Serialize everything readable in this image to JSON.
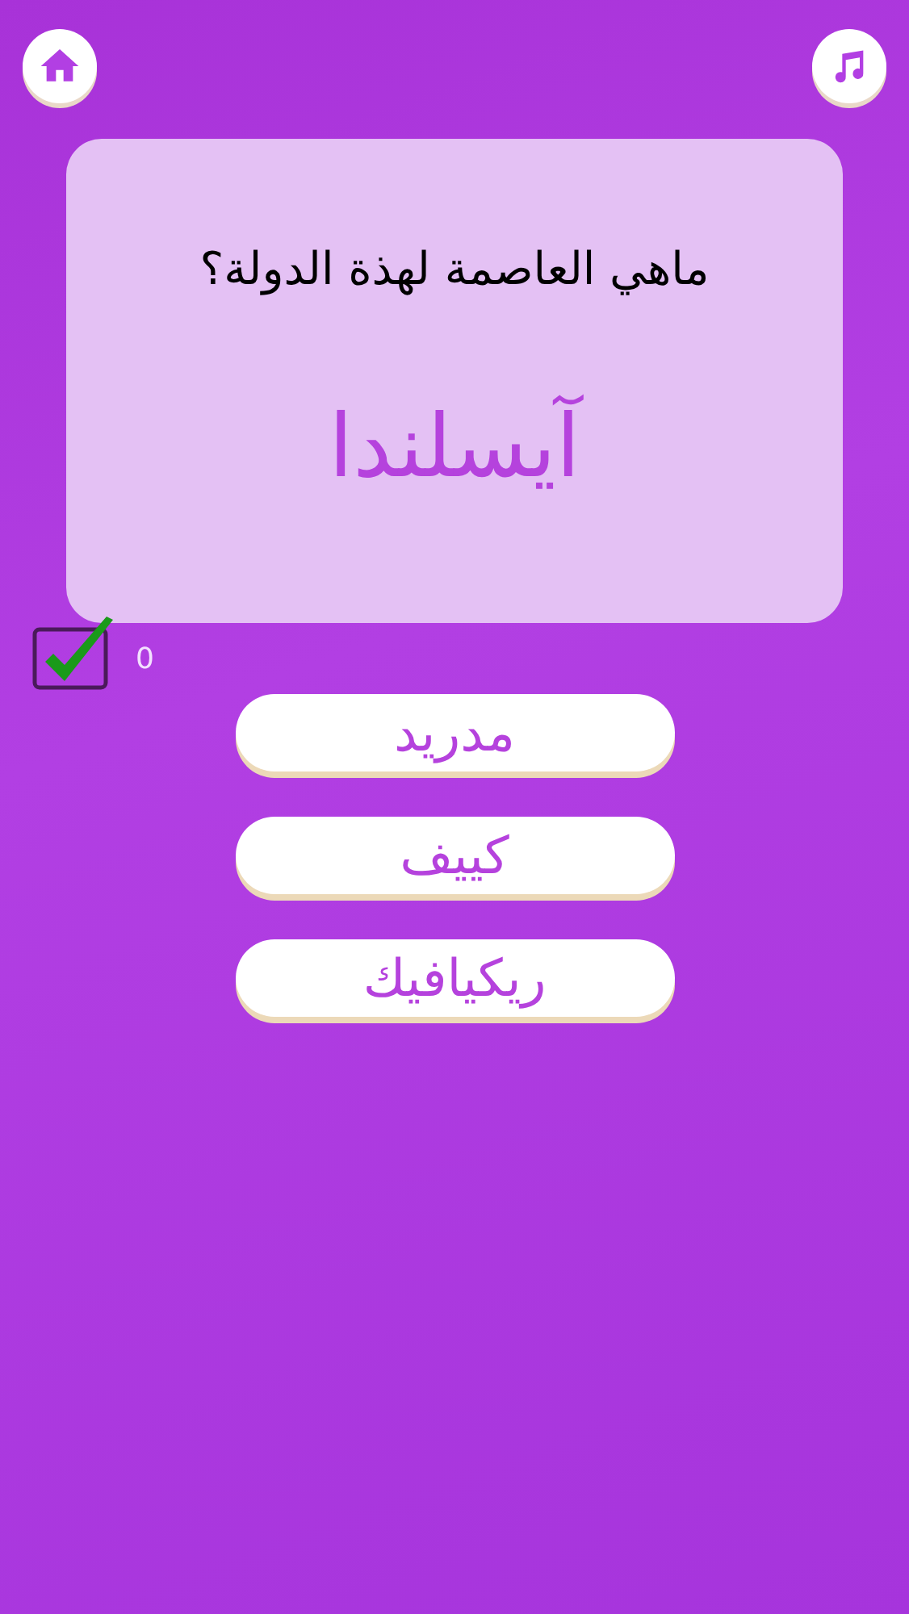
{
  "question": {
    "prompt": "ماهي العاصمة لهذة الدولة؟",
    "subject": "آيسلندا"
  },
  "score": {
    "correct": "0"
  },
  "answers": [
    {
      "label": "مدريد"
    },
    {
      "label": "كييف"
    },
    {
      "label": "ريكيافيك"
    }
  ]
}
